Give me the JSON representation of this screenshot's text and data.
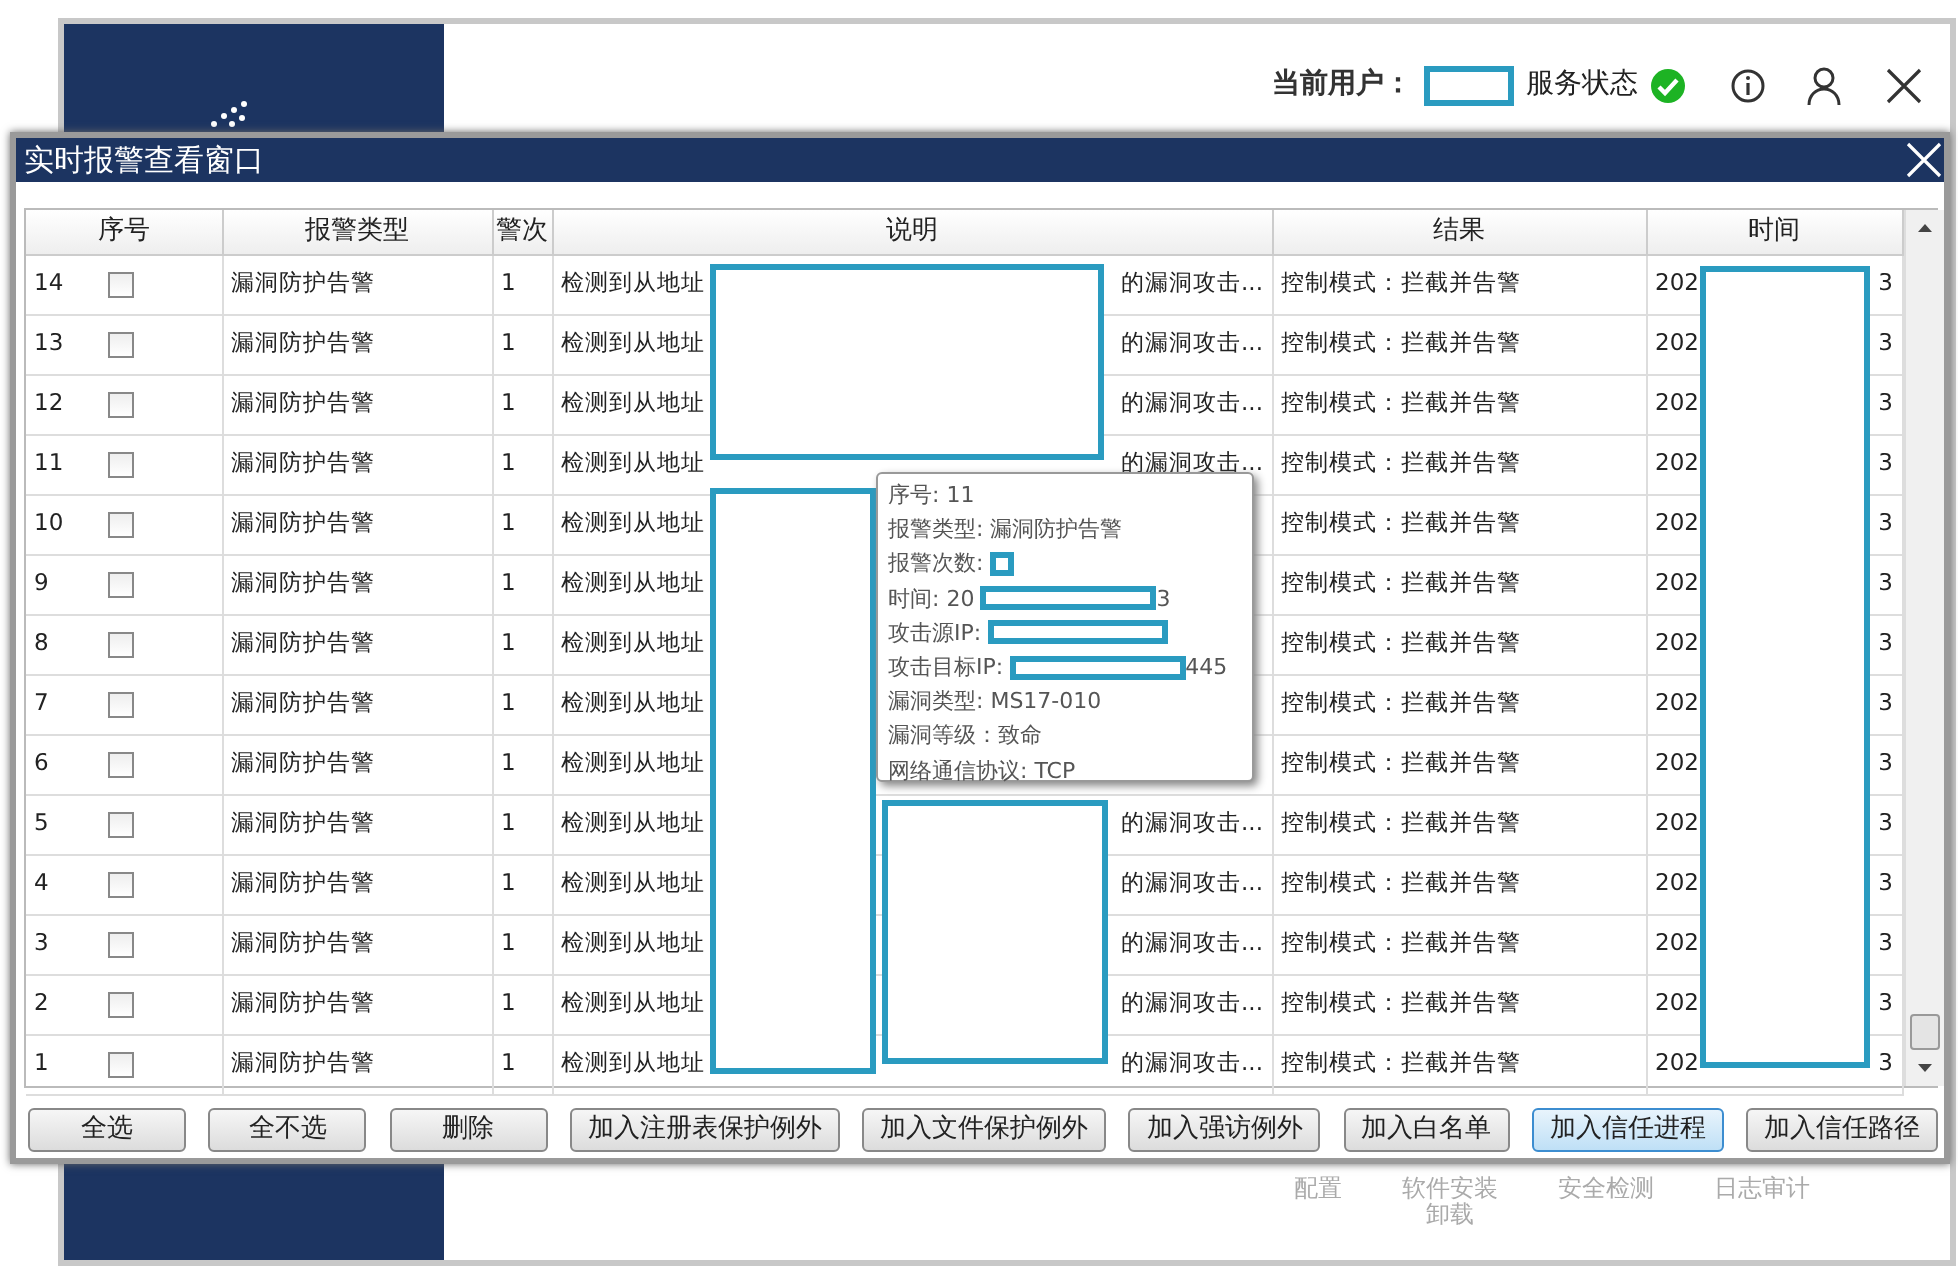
{
  "app": {
    "header": {
      "user_label": "当前用户：",
      "user_masked": true,
      "status_label": "服务状态",
      "status_ok": true
    },
    "nav": [
      {
        "lines": [
          "配置"
        ]
      },
      {
        "lines": [
          "软件安装",
          "卸载"
        ]
      },
      {
        "lines": [
          "安全检测"
        ]
      },
      {
        "lines": [
          "日志审计"
        ]
      }
    ]
  },
  "dialog": {
    "title": "实时报警查看窗口",
    "table": {
      "columns": [
        "序号",
        "报警类型",
        "警次",
        "说明",
        "结果",
        "时间"
      ],
      "rows": [
        {
          "index": "14",
          "checked": false,
          "type": "漏洞防护告警",
          "count": "1",
          "description_start": "检测到从地址",
          "description_end": "的漏洞攻击...",
          "result": "控制模式：拦截并告警",
          "time_start": "202",
          "time_end": "3"
        },
        {
          "index": "13",
          "checked": false,
          "type": "漏洞防护告警",
          "count": "1",
          "description_start": "检测到从地址",
          "description_end": "的漏洞攻击...",
          "result": "控制模式：拦截并告警",
          "time_start": "202",
          "time_end": "3"
        },
        {
          "index": "12",
          "checked": false,
          "type": "漏洞防护告警",
          "count": "1",
          "description_start": "检测到从地址",
          "description_end": "的漏洞攻击...",
          "result": "控制模式：拦截并告警",
          "time_start": "202",
          "time_end": "3"
        },
        {
          "index": "11",
          "checked": false,
          "type": "漏洞防护告警",
          "count": "1",
          "description_start": "检测到从地址",
          "description_end": "的漏洞攻击...",
          "result": "控制模式：拦截并告警",
          "time_start": "202",
          "time_end": "3"
        },
        {
          "index": "10",
          "checked": false,
          "type": "漏洞防护告警",
          "count": "1",
          "description_start": "检测到从地址",
          "result": "控制模式：拦截并告警",
          "time_start": "202",
          "time_end": "3"
        },
        {
          "index": "9",
          "checked": false,
          "type": "漏洞防护告警",
          "count": "1",
          "description_start": "检测到从地址",
          "result": "控制模式：拦截并告警",
          "time_start": "202",
          "time_end": "3"
        },
        {
          "index": "8",
          "checked": false,
          "type": "漏洞防护告警",
          "count": "1",
          "description_start": "检测到从地址",
          "result": "控制模式：拦截并告警",
          "time_start": "202",
          "time_end": "3"
        },
        {
          "index": "7",
          "checked": false,
          "type": "漏洞防护告警",
          "count": "1",
          "description_start": "检测到从地址",
          "result": "控制模式：拦截并告警",
          "time_start": "202",
          "time_end": "3"
        },
        {
          "index": "6",
          "checked": false,
          "type": "漏洞防护告警",
          "count": "1",
          "description_start": "检测到从地址",
          "result": "控制模式：拦截并告警",
          "time_start": "202",
          "time_end": "3"
        },
        {
          "index": "5",
          "checked": false,
          "type": "漏洞防护告警",
          "count": "1",
          "description_start": "检测到从地址",
          "description_end": "的漏洞攻击...",
          "result": "控制模式：拦截并告警",
          "time_start": "202",
          "time_end": "3"
        },
        {
          "index": "4",
          "checked": false,
          "type": "漏洞防护告警",
          "count": "1",
          "description_start": "检测到从地址",
          "description_end": "的漏洞攻击...",
          "result": "控制模式：拦截并告警",
          "time_start": "202",
          "time_end": "3"
        },
        {
          "index": "3",
          "checked": false,
          "type": "漏洞防护告警",
          "count": "1",
          "description_start": "检测到从地址",
          "description_end": "的漏洞攻击...",
          "result": "控制模式：拦截并告警",
          "time_start": "202",
          "time_end": "3"
        },
        {
          "index": "2",
          "checked": false,
          "type": "漏洞防护告警",
          "count": "1",
          "description_start": "检测到从地址",
          "description_end": "的漏洞攻击...",
          "result": "控制模式：拦截并告警",
          "time_start": "202",
          "time_end": "3"
        },
        {
          "index": "1",
          "checked": false,
          "type": "漏洞防护告警",
          "count": "1",
          "description_start": "检测到从地址",
          "description_end": "的漏洞攻击...",
          "result": "控制模式：拦截并告警",
          "time_start": "202",
          "time_end": "3"
        }
      ]
    },
    "tooltip": {
      "lines": [
        {
          "text": "序号: 11"
        },
        {
          "text": "报警类型: 漏洞防护告警"
        },
        {
          "text": "报警次数:",
          "masked": true
        },
        {
          "text": "时间: 20",
          "masked": true,
          "after": "3"
        },
        {
          "text": "攻击源IP:",
          "masked": true
        },
        {
          "text": "攻击目标IP:",
          "masked": true,
          "after": "445"
        },
        {
          "text": "漏洞类型: MS17-010"
        },
        {
          "text": "漏洞等级：致命"
        },
        {
          "text": "网络通信协议: TCP"
        }
      ]
    },
    "buttons": [
      {
        "label": "全选",
        "focused": false
      },
      {
        "label": "全不选",
        "focused": false
      },
      {
        "label": "删除",
        "focused": false
      },
      {
        "label": "加入注册表保护例外",
        "focused": false
      },
      {
        "label": "加入文件保护例外",
        "focused": false
      },
      {
        "label": "加入强访例外",
        "focused": false
      },
      {
        "label": "加入白名单",
        "focused": false
      },
      {
        "label": "加入信任进程",
        "focused": true
      },
      {
        "label": "加入信任路径",
        "focused": false
      }
    ]
  }
}
